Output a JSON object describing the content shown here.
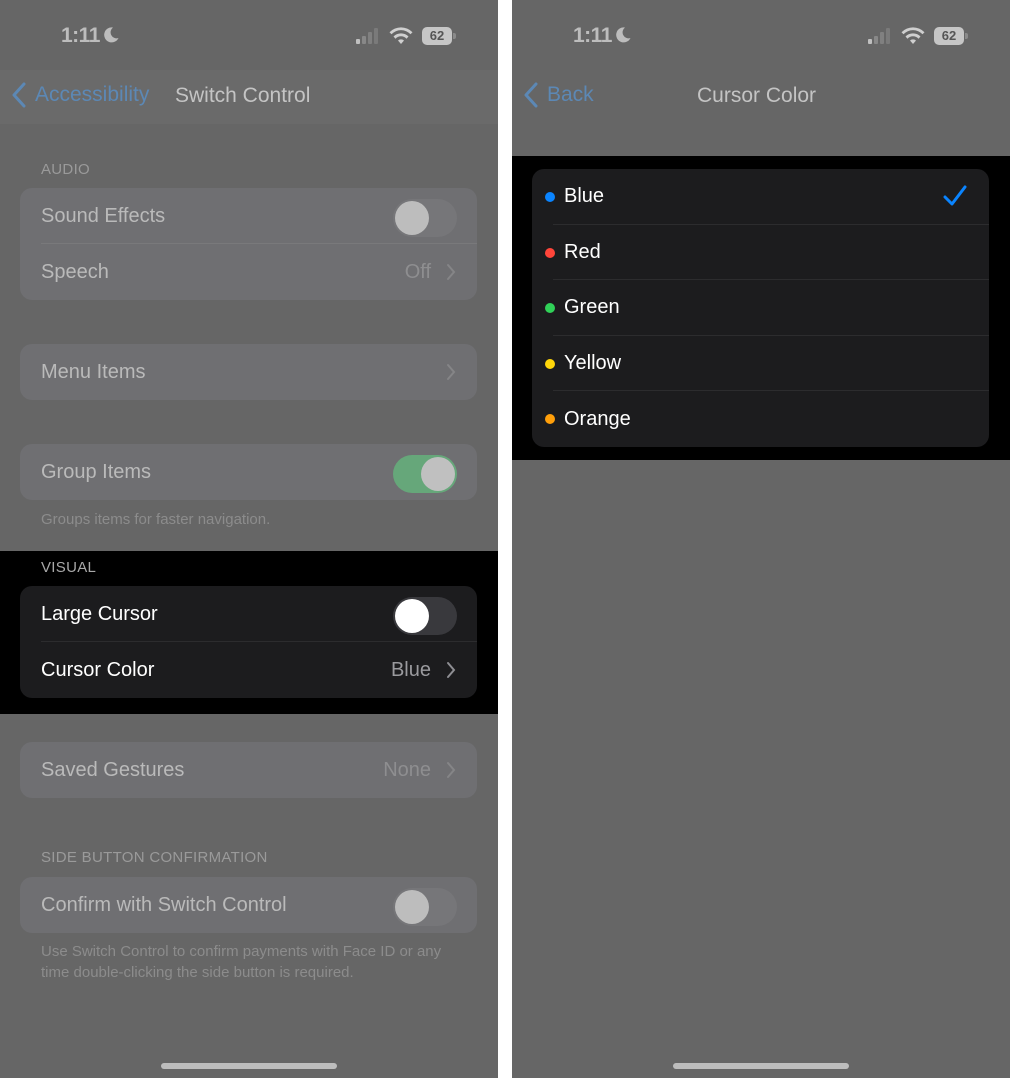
{
  "left_screen": {
    "status_bar": {
      "time": "1:11",
      "battery": "62",
      "focus_icon": "moon-icon"
    },
    "nav": {
      "back_label": "Accessibility",
      "title": "Switch Control"
    },
    "sections": {
      "audio": {
        "header": "AUDIO",
        "rows": [
          {
            "label": "Sound Effects",
            "control": "toggle",
            "on": false
          },
          {
            "label": "Speech",
            "value": "Off"
          }
        ]
      },
      "menu": {
        "rows": [
          {
            "label": "Menu Items"
          }
        ]
      },
      "group": {
        "rows": [
          {
            "label": "Group Items",
            "control": "toggle",
            "on": true
          }
        ],
        "footer": "Groups items for faster navigation."
      },
      "visual": {
        "header": "VISUAL",
        "rows": [
          {
            "label": "Large Cursor",
            "control": "toggle",
            "on": false
          },
          {
            "label": "Cursor Color",
            "value": "Blue"
          }
        ]
      },
      "gestures": {
        "rows": [
          {
            "label": "Saved Gestures",
            "value": "None"
          }
        ]
      },
      "side_button": {
        "header": "SIDE BUTTON CONFIRMATION",
        "rows": [
          {
            "label": "Confirm with Switch Control",
            "control": "toggle",
            "on": false
          }
        ],
        "footer": "Use Switch Control to confirm payments with Face ID or any time double-clicking the side button is required."
      }
    }
  },
  "right_screen": {
    "status_bar": {
      "time": "1:11",
      "battery": "62",
      "focus_icon": "moon-icon"
    },
    "nav": {
      "back_label": "Back",
      "title": "Cursor Color"
    },
    "selected": "Blue",
    "colors": [
      {
        "label": "Blue",
        "dot": "#0a84ff",
        "selected": true
      },
      {
        "label": "Red",
        "dot": "#ff453a",
        "selected": false
      },
      {
        "label": "Green",
        "dot": "#30d158",
        "selected": false
      },
      {
        "label": "Yellow",
        "dot": "#ffd60a",
        "selected": false
      },
      {
        "label": "Orange",
        "dot": "#ff9f0a",
        "selected": false
      }
    ],
    "accent": "#0a84ff"
  }
}
